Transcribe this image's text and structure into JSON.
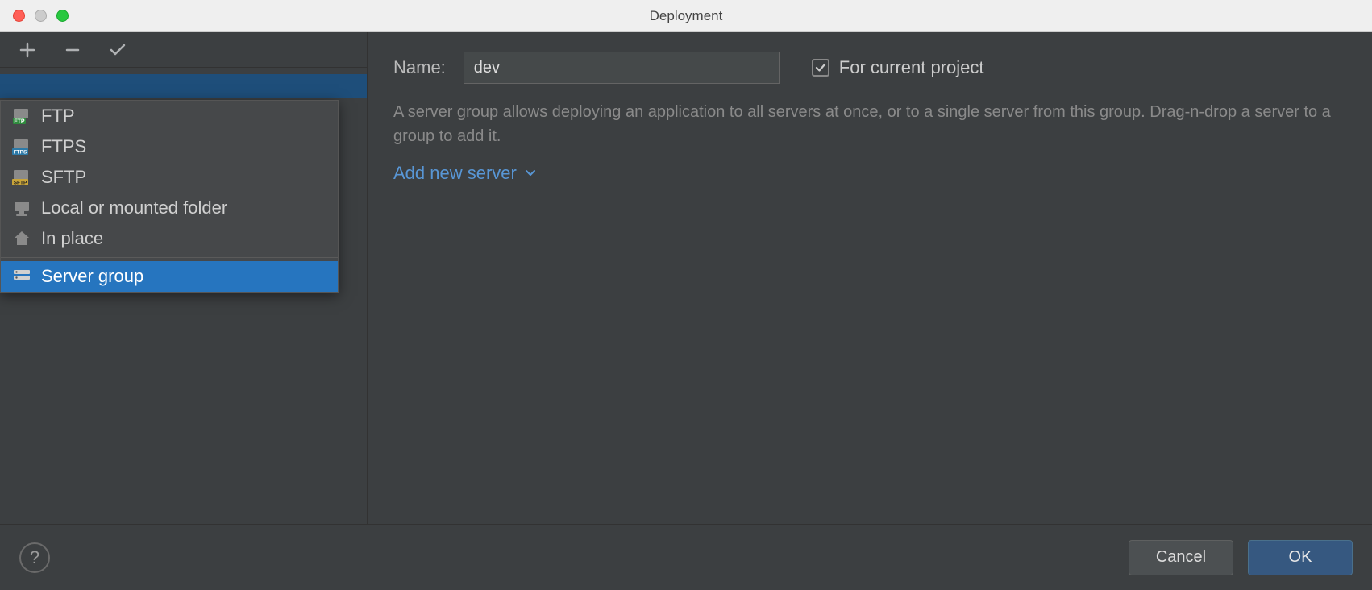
{
  "window": {
    "title": "Deployment"
  },
  "menu": {
    "items": [
      {
        "label": "FTP",
        "badge": "FTP",
        "badge_bg": "#2e8b3d"
      },
      {
        "label": "FTPS",
        "badge": "FTPS",
        "badge_bg": "#2d7aa8"
      },
      {
        "label": "SFTP",
        "badge": "SFTP",
        "badge_bg": "#c8a43a"
      },
      {
        "label": "Local or mounted folder"
      },
      {
        "label": "In place"
      }
    ],
    "group_label": "Server group"
  },
  "form": {
    "name_label": "Name:",
    "name_value": "dev",
    "for_project_label": "For current project",
    "for_project_checked": true,
    "description": "A server group allows deploying an application to all servers at once, or to a single server from this group. Drag-n-drop a server to a group to add it.",
    "add_server_label": "Add new server"
  },
  "footer": {
    "help": "?",
    "cancel": "Cancel",
    "ok": "OK"
  }
}
